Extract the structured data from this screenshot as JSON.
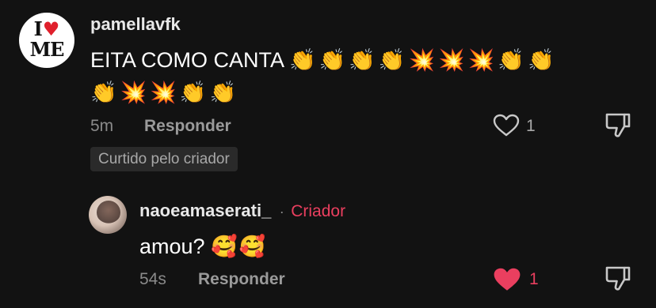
{
  "comment1": {
    "avatar_text_line1_letter": "I",
    "avatar_text_line2": "ME",
    "username": "pamellavfk",
    "text_line1": "EITA COMO CANTA",
    "emojis_line1": "👏👏👏👏💥💥💥👏👏",
    "emojis_line2": "👏💥💥👏👏",
    "time": "5m",
    "reply_label": "Responder",
    "like_count": "1",
    "badge": "Curtido pelo criador"
  },
  "comment2": {
    "username": "naoeamaserati_",
    "separator": "·",
    "creator_label": "Criador",
    "text": "amou?",
    "emojis": "🥰🥰",
    "time": "54s",
    "reply_label": "Responder",
    "like_count": "1",
    "liked": true
  },
  "colors": {
    "background": "#121212",
    "creator_accent": "#ea3f5f",
    "liked_heart": "#ea3f5f"
  },
  "icons": {
    "like_outline": "heart-outline-icon",
    "like_filled": "heart-filled-icon",
    "dislike": "thumbs-down-icon"
  }
}
